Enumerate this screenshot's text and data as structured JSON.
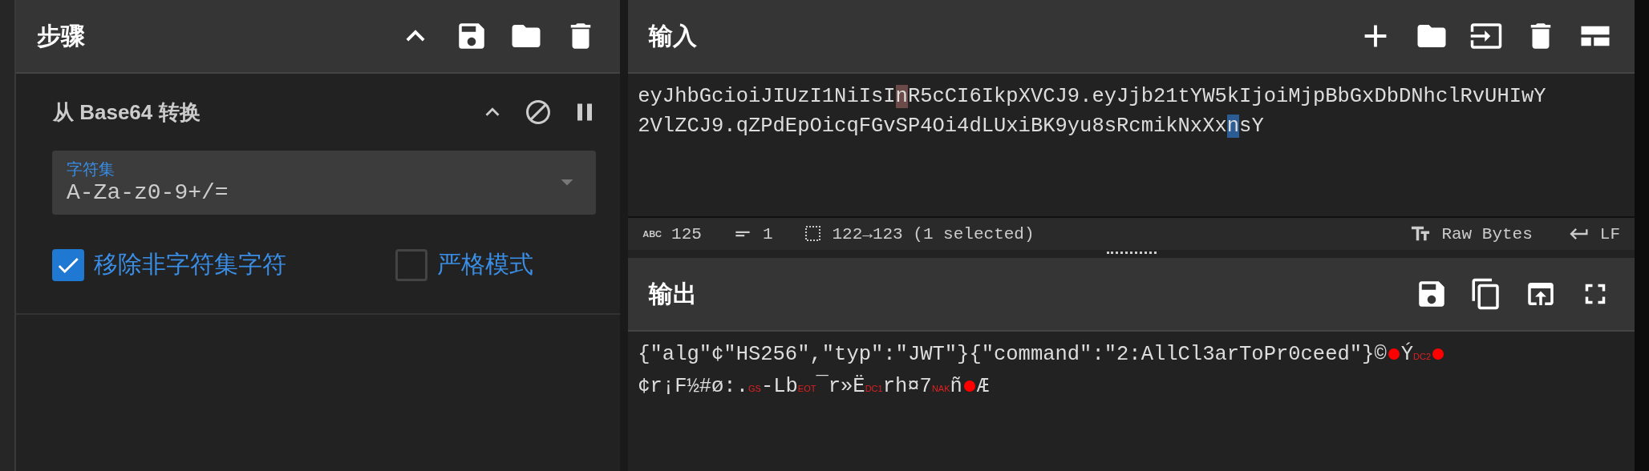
{
  "recipe": {
    "title": "步骤",
    "operation": {
      "name": "从 Base64 转换",
      "field": {
        "label": "字符集",
        "value": "A-Za-z0-9+/="
      },
      "options": [
        {
          "label": "移除非字符集字符",
          "checked": true
        },
        {
          "label": "严格模式",
          "checked": false
        }
      ]
    }
  },
  "input": {
    "title": "输入",
    "lines": [
      [
        {
          "kind": "plain",
          "text": "eyJhbGcioiJIUzI1NiIsI"
        },
        {
          "kind": "match",
          "text": "n"
        },
        {
          "kind": "plain",
          "text": "R5cCI6IkpXVCJ9.eyJjb21tYW5kIjoiMjpBbGxDbDNhclRvUHIwY"
        }
      ],
      [
        {
          "kind": "plain",
          "text": "2VlZCJ9.qZPdEpOicqFGvSP4Oi4dLUxiBK9yu8sRcmikNxXx"
        },
        {
          "kind": "selected",
          "text": "n"
        },
        {
          "kind": "plain",
          "text": "sY"
        }
      ]
    ]
  },
  "status": {
    "abc": "ABC",
    "length": "125",
    "lines": "1",
    "selection": "122→123 (1 selected)",
    "encoding": "Raw Bytes",
    "eol": "LF"
  },
  "output": {
    "title": "输出",
    "lines": [
      [
        {
          "kind": "plain",
          "text": "{\"alg\"¢\"HS256\",\"typ\":\"JWT\"}{\"command\":\"2:AllCl3arToPr0ceed\"}©"
        },
        {
          "kind": "dot"
        },
        {
          "kind": "plain",
          "text": "Ý"
        },
        {
          "kind": "control",
          "text": "DC2"
        },
        {
          "kind": "dot"
        }
      ],
      [
        {
          "kind": "plain",
          "text": "¢r¡F½#ø:."
        },
        {
          "kind": "control",
          "text": "GS"
        },
        {
          "kind": "plain",
          "text": "-Lb"
        },
        {
          "kind": "control",
          "text": "EOT"
        },
        {
          "kind": "plain",
          "text": "¯r»Ë"
        },
        {
          "kind": "control",
          "text": "DC1"
        },
        {
          "kind": "plain",
          "text": "rh¤7"
        },
        {
          "kind": "control",
          "text": "NAK"
        },
        {
          "kind": "plain",
          "text": "ñ"
        },
        {
          "kind": "dot"
        },
        {
          "kind": "plain",
          "text": "Æ"
        }
      ]
    ]
  }
}
